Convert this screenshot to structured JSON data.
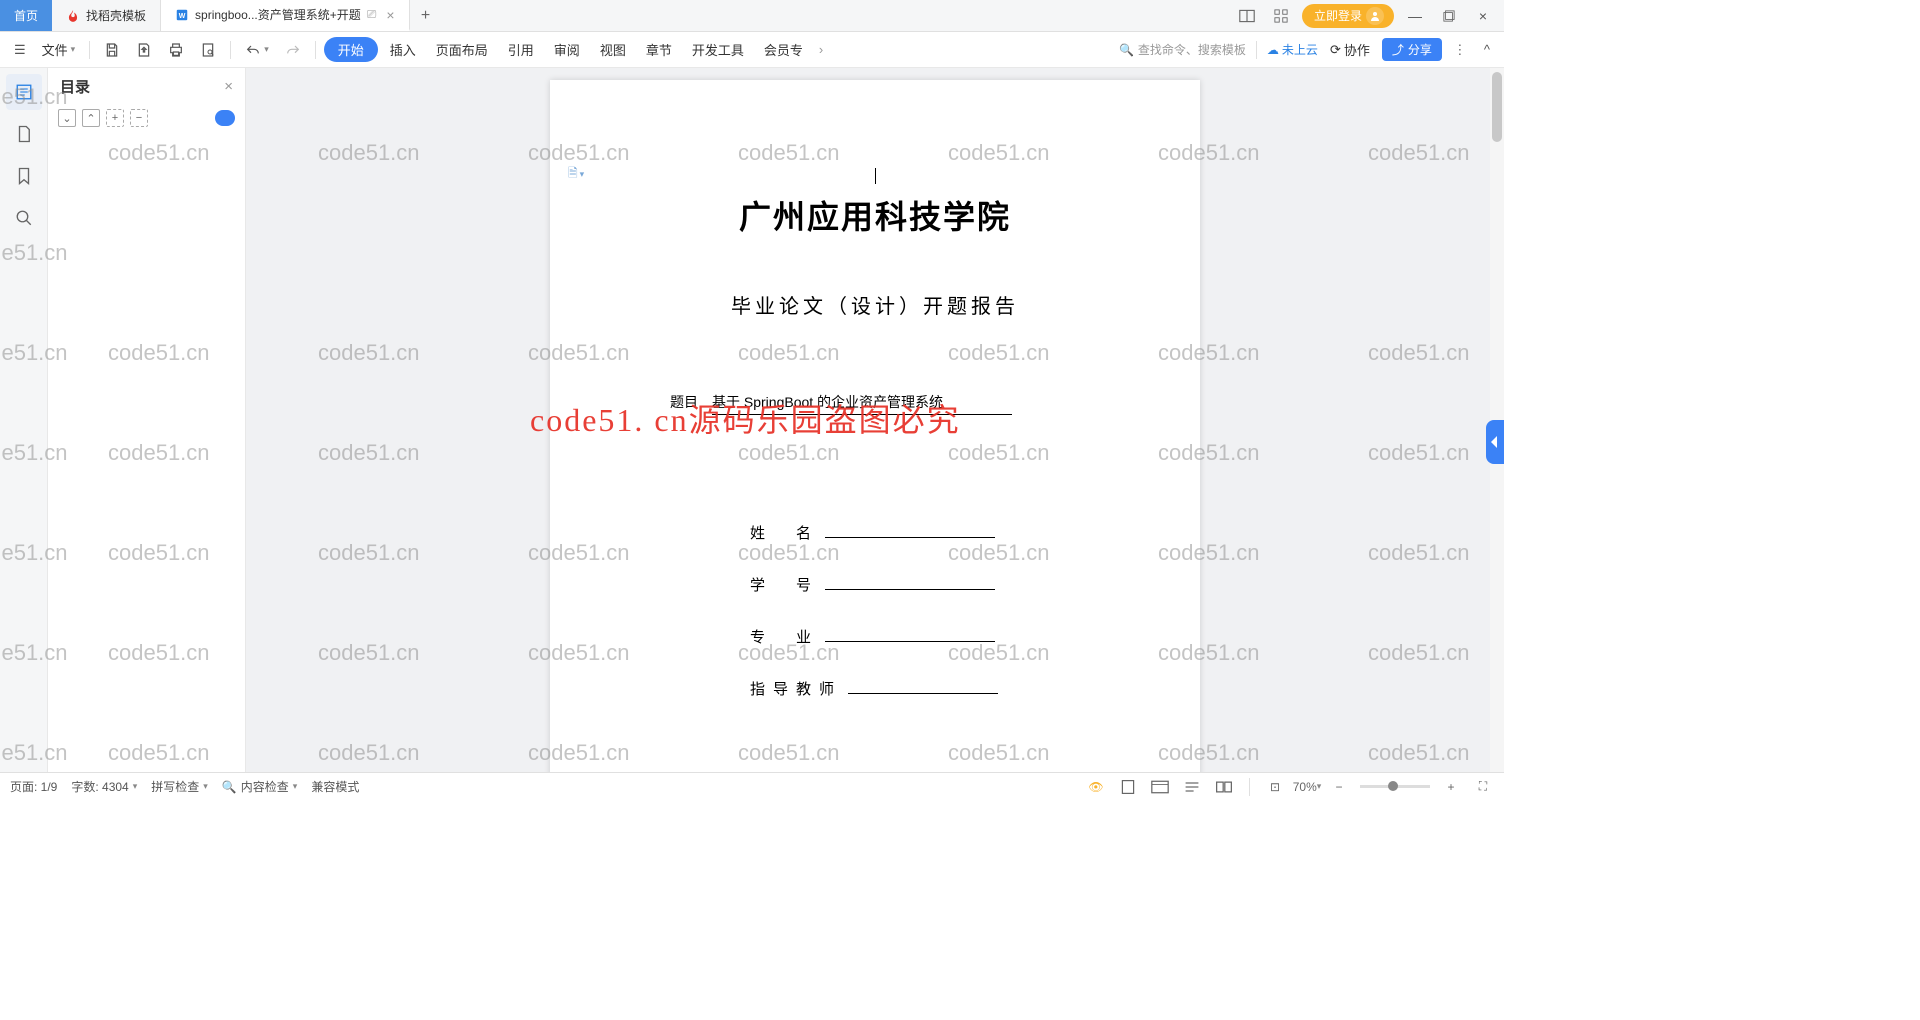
{
  "tabs": {
    "home": "首页",
    "t1": "找稻壳模板",
    "t2": "springboo...资产管理系统+开题"
  },
  "login_label": "立即登录",
  "toolbar": {
    "file": "文件",
    "start": "开始",
    "menus": [
      "插入",
      "页面布局",
      "引用",
      "审阅",
      "视图",
      "章节",
      "开发工具",
      "会员专"
    ],
    "search_placeholder": "查找命令、搜索模板",
    "cloud": "未上云",
    "collab": "协作",
    "share": "分享"
  },
  "outline": {
    "title": "目录"
  },
  "document": {
    "university": "广州应用科技学院",
    "subtitle": "毕业论文（设计）开题报告",
    "topic_label": "题目",
    "topic_value": "基于 SpringBoot 的企业资产管理系统",
    "fields": {
      "name": "姓　名",
      "id": "学　号",
      "major": "专　业",
      "advisor": "指导教师"
    }
  },
  "watermark": {
    "text": "code51.cn",
    "big": "code51. cn源码乐园盗图必究"
  },
  "status": {
    "page": "页面: 1/9",
    "words": "字数: 4304",
    "spell": "拼写检查",
    "content": "内容检查",
    "compat": "兼容模式",
    "zoom": "70%"
  }
}
